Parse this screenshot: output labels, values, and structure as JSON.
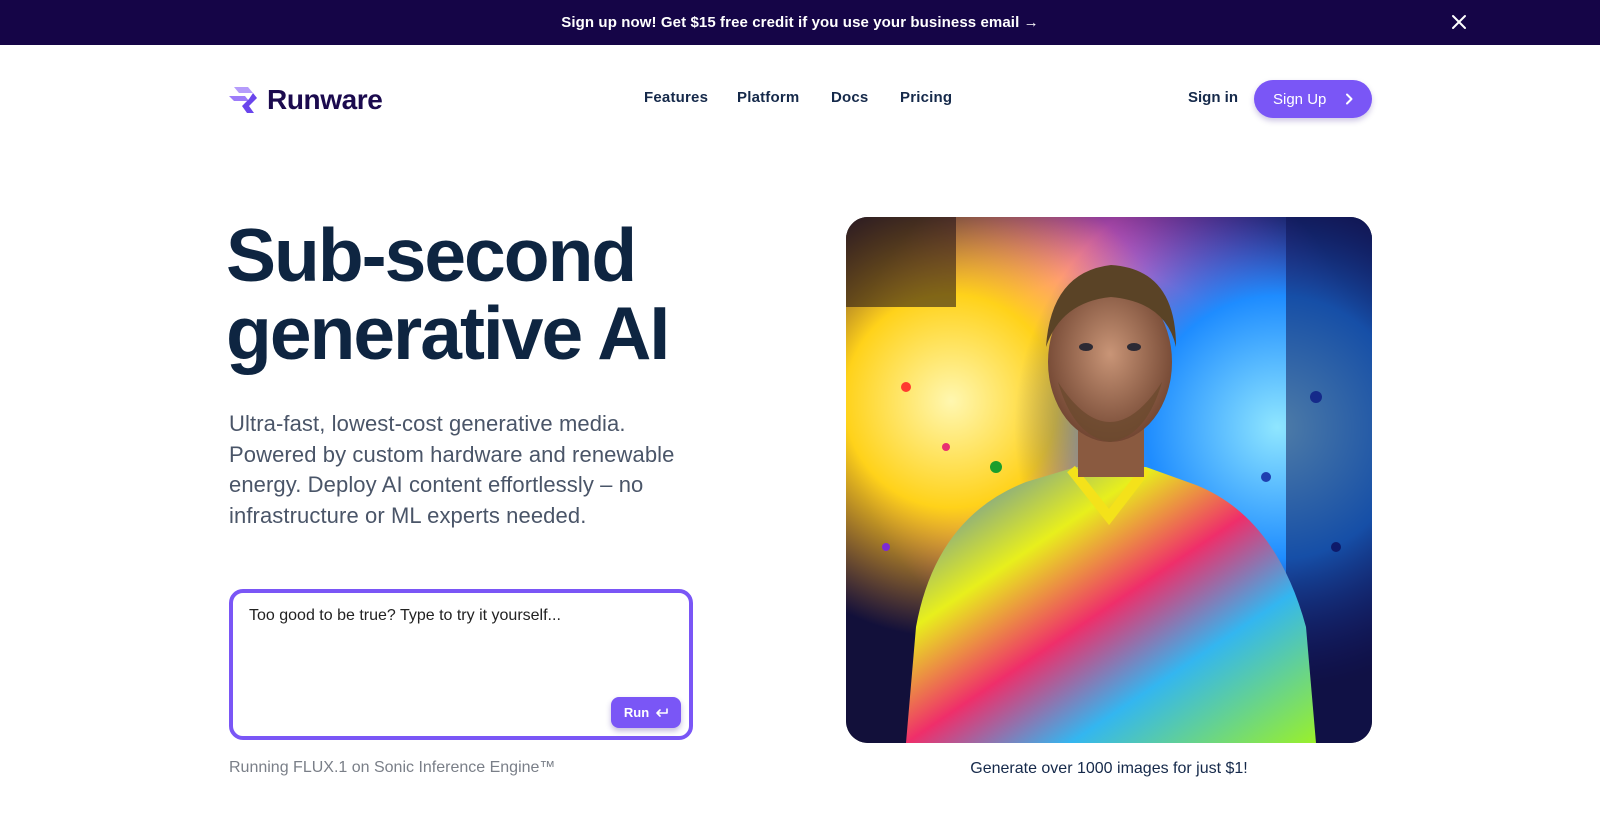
{
  "banner": {
    "text": "Sign up now! Get $15 free credit if you use your business email →",
    "close_icon": "close-icon"
  },
  "header": {
    "logo_text": "Runware",
    "nav": [
      {
        "label": "Features"
      },
      {
        "label": "Platform"
      },
      {
        "label": "Docs"
      },
      {
        "label": "Pricing"
      }
    ],
    "sign_in": "Sign in",
    "sign_up": "Sign Up"
  },
  "hero": {
    "headline_line1": "Sub-second",
    "headline_line2": "generative AI",
    "subtext": "Ultra-fast, lowest-cost generative media. Powered by custom hardware and renewable energy. Deploy AI content effortlessly – no infrastructure or ML experts needed.",
    "prompt": {
      "placeholder": "Too good to be true? Type to try it yourself...",
      "value": "",
      "run_label": "Run"
    },
    "engine_note": "Running FLUX.1 on Sonic Inference Engine™",
    "image_alt": "Man in a paint-splattered shirt against a colorful paint explosion background",
    "image_caption": "Generate over 1000 images for just $1!"
  },
  "colors": {
    "banner_bg": "#150547",
    "accent": "#7a56f6",
    "heading": "#0e2541",
    "body_text": "#4a5568",
    "muted": "#7a7f88"
  }
}
